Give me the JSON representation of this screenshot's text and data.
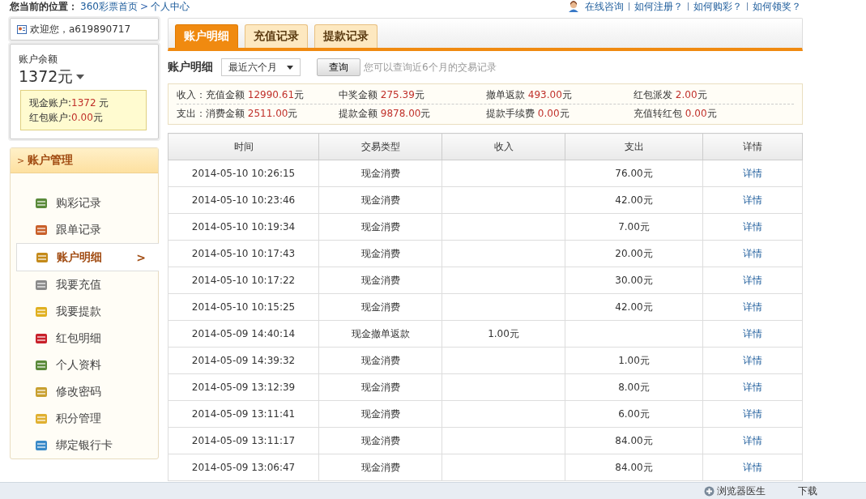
{
  "breadcrumb": {
    "label": "您当前的位置：",
    "links": [
      "360彩票首页",
      "个人中心"
    ],
    "separator": ">"
  },
  "help_links": [
    "在线咨询",
    "如何注册？",
    "如何购彩？",
    "如何领奖？"
  ],
  "user": {
    "welcome": "欢迎您，a619890717"
  },
  "balance": {
    "label": "账户余额",
    "amount": "1372元",
    "popup": [
      {
        "label": "现金账户:",
        "value": "1372",
        "unit": " 元"
      },
      {
        "label": "红包账户:",
        "value": "0.00",
        "unit": "元"
      }
    ]
  },
  "sidebar": {
    "title": "账户管理",
    "arrow": ">",
    "items": [
      {
        "label": "购彩记录",
        "selected": false
      },
      {
        "label": "跟单记录",
        "selected": false
      },
      {
        "label": "账户明细",
        "selected": true
      },
      {
        "label": "我要充值",
        "selected": false
      },
      {
        "label": "我要提款",
        "selected": false
      },
      {
        "label": "红包明细",
        "selected": false
      },
      {
        "label": "个人资料",
        "selected": false
      },
      {
        "label": "修改密码",
        "selected": false
      },
      {
        "label": "积分管理",
        "selected": false
      },
      {
        "label": "绑定银行卡",
        "selected": false
      }
    ]
  },
  "tabs": [
    {
      "label": "账户明细",
      "selected": true
    },
    {
      "label": "充值记录",
      "selected": false
    },
    {
      "label": "提款记录",
      "selected": false
    }
  ],
  "filter": {
    "title": "账户明细",
    "period": "最近六个月",
    "button": "查询",
    "hint": "您可以查询近6个月的交易记录"
  },
  "summary": [
    {
      "prefix": "收入：",
      "items": [
        {
          "label": "充值金额",
          "value": "12990.61",
          "unit": "元"
        },
        {
          "label": "中奖金额",
          "value": "275.39",
          "unit": "元"
        },
        {
          "label": "撤单返款",
          "value": "493.00",
          "unit": "元"
        },
        {
          "label": "红包派发",
          "value": "2.00",
          "unit": "元"
        }
      ]
    },
    {
      "prefix": "支出：",
      "items": [
        {
          "label": "消费金额",
          "value": "2511.00",
          "unit": "元"
        },
        {
          "label": "提款金额",
          "value": "9878.00",
          "unit": "元"
        },
        {
          "label": "提款手续费",
          "value": "0.00",
          "unit": "元"
        },
        {
          "label": "充值转红包",
          "value": "0.00",
          "unit": "元"
        }
      ]
    }
  ],
  "table": {
    "columns": [
      "时间",
      "交易类型",
      "收入",
      "支出",
      "详情"
    ],
    "rows": [
      {
        "time": "2014-05-10 10:26:15",
        "type": "现金消费",
        "income": "",
        "expense": "76.00元",
        "detail": "详情"
      },
      {
        "time": "2014-05-10 10:23:46",
        "type": "现金消费",
        "income": "",
        "expense": "42.00元",
        "detail": "详情"
      },
      {
        "time": "2014-05-10 10:19:34",
        "type": "现金消费",
        "income": "",
        "expense": "7.00元",
        "detail": "详情"
      },
      {
        "time": "2014-05-10 10:17:43",
        "type": "现金消费",
        "income": "",
        "expense": "20.00元",
        "detail": "详情"
      },
      {
        "time": "2014-05-10 10:17:22",
        "type": "现金消费",
        "income": "",
        "expense": "30.00元",
        "detail": "详情"
      },
      {
        "time": "2014-05-10 10:15:25",
        "type": "现金消费",
        "income": "",
        "expense": "42.00元",
        "detail": "详情"
      },
      {
        "time": "2014-05-09 14:40:14",
        "type": "现金撤单返款",
        "income": "1.00元",
        "expense": "",
        "detail": "详情"
      },
      {
        "time": "2014-05-09 14:39:32",
        "type": "现金消费",
        "income": "",
        "expense": "1.00元",
        "detail": "详情"
      },
      {
        "time": "2014-05-09 13:12:39",
        "type": "现金消费",
        "income": "",
        "expense": "8.00元",
        "detail": "详情"
      },
      {
        "time": "2014-05-09 13:11:41",
        "type": "现金消费",
        "income": "",
        "expense": "6.00元",
        "detail": "详情"
      },
      {
        "time": "2014-05-09 13:11:17",
        "type": "现金消费",
        "income": "",
        "expense": "84.00元",
        "detail": "详情"
      },
      {
        "time": "2014-05-09 13:06:47",
        "type": "现金消费",
        "income": "",
        "expense": "84.00元",
        "detail": "详情"
      }
    ]
  },
  "status_bar": {
    "items": [
      "浏览器医生",
      "下载"
    ]
  }
}
